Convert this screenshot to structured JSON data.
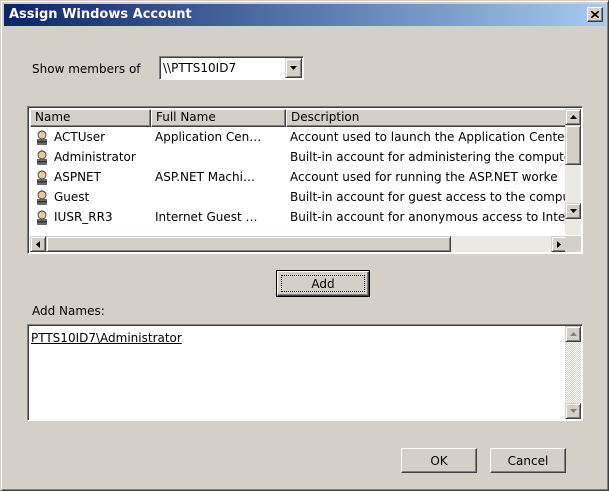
{
  "window": {
    "title": "Assign Windows Account"
  },
  "show_members": {
    "label": "Show members of",
    "value": "\\\\PTTS10ID7"
  },
  "accounts_list": {
    "columns": [
      "Name",
      "Full Name",
      "Description"
    ],
    "rows": [
      {
        "name": "ACTUser",
        "full_name": "Application Cen…",
        "description": "Account used to launch the Application Cente"
      },
      {
        "name": "Administrator",
        "full_name": "",
        "description": "Built-in account for administering the compute"
      },
      {
        "name": "ASPNET",
        "full_name": "ASP.NET Machi…",
        "description": "Account used for running the ASP.NET worke"
      },
      {
        "name": "Guest",
        "full_name": "",
        "description": "Built-in account for guest access to the compu"
      },
      {
        "name": "IUSR_RR3",
        "full_name": "Internet Guest …",
        "description": "Built-in account for anonymous access to Inte"
      }
    ],
    "icon": "user-icon"
  },
  "add_button": {
    "label": "Add"
  },
  "add_names": {
    "label": "Add Names:",
    "value": "PTTS10ID7\\Administrator"
  },
  "footer": {
    "ok_label": "OK",
    "cancel_label": "Cancel"
  },
  "colors": {
    "title_start": "#0a246a",
    "title_end": "#a6caf0",
    "face": "#d4d0c8"
  }
}
